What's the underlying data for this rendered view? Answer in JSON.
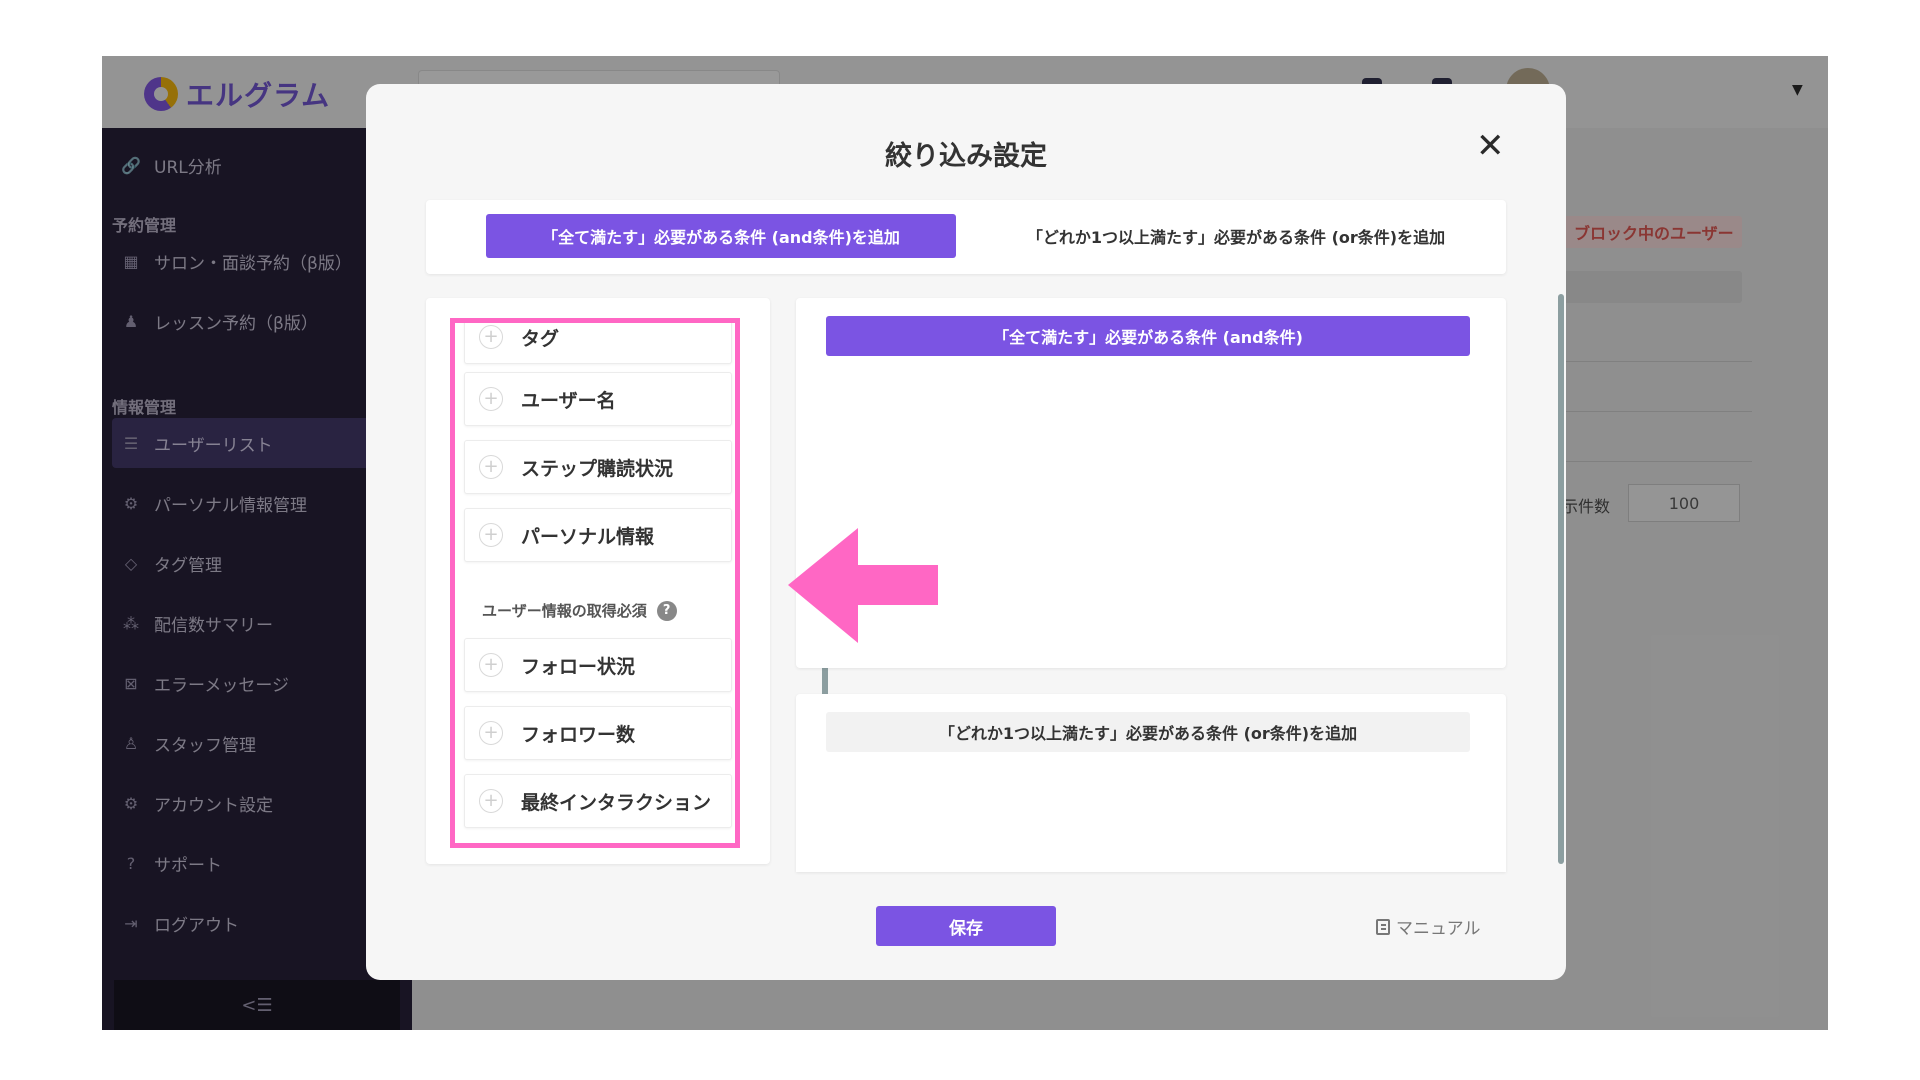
{
  "app": {
    "logo_text": "エルグラム"
  },
  "sidebar": {
    "items": [
      {
        "label": "URL分析",
        "icon": "link-icon"
      },
      {
        "label": "サロン・面談予約（β版）",
        "icon": "calendar-icon"
      },
      {
        "label": "レッスン予約（β版）",
        "icon": "lesson-icon"
      },
      {
        "label": "ユーザーリスト",
        "icon": "user-list-icon"
      },
      {
        "label": "パーソナル情報管理",
        "icon": "personal-info-icon"
      },
      {
        "label": "タグ管理",
        "icon": "tag-icon"
      },
      {
        "label": "配信数サマリー",
        "icon": "summary-icon"
      },
      {
        "label": "エラーメッセージ",
        "icon": "error-message-icon"
      },
      {
        "label": "スタッフ管理",
        "icon": "staff-icon"
      },
      {
        "label": "アカウント設定",
        "icon": "gear-icon"
      },
      {
        "label": "サポート",
        "icon": "help-icon"
      },
      {
        "label": "ログアウト",
        "icon": "logout-icon"
      }
    ],
    "heads": {
      "reservation": "予約管理",
      "info": "情報管理"
    },
    "collapse_glyph": "<☰"
  },
  "background": {
    "blocked_badge": "ブロック中のユーザー",
    "display_count_label": "示件数",
    "display_count_value": "100"
  },
  "modal": {
    "title": "絞り込み設定",
    "close_glyph": "✕",
    "tab_and": "「全て満たす」必要がある条件 (and条件)を追加",
    "tab_or": "「どれか1つ以上満たす」必要がある条件 (or条件)を追加",
    "conditions": [
      {
        "label": "タグ"
      },
      {
        "label": "ユーザー名"
      },
      {
        "label": "ステップ購読状況"
      },
      {
        "label": "パーソナル情報"
      }
    ],
    "subsection": "ユーザー情報の取得必須",
    "conditions_required": [
      {
        "label": "フォロー状況"
      },
      {
        "label": "フォロワー数"
      },
      {
        "label": "最終インタラクション"
      }
    ],
    "and_header": "「全て満たす」必要がある条件 (and条件)",
    "or_header": "「どれか1つ以上満たす」必要がある条件 (or条件)を追加",
    "save": "保存",
    "manual": "マニュアル"
  },
  "colors": {
    "accent": "#7b54e3",
    "highlight": "#ff67c4",
    "sidebar_bg": "#1c1530"
  }
}
